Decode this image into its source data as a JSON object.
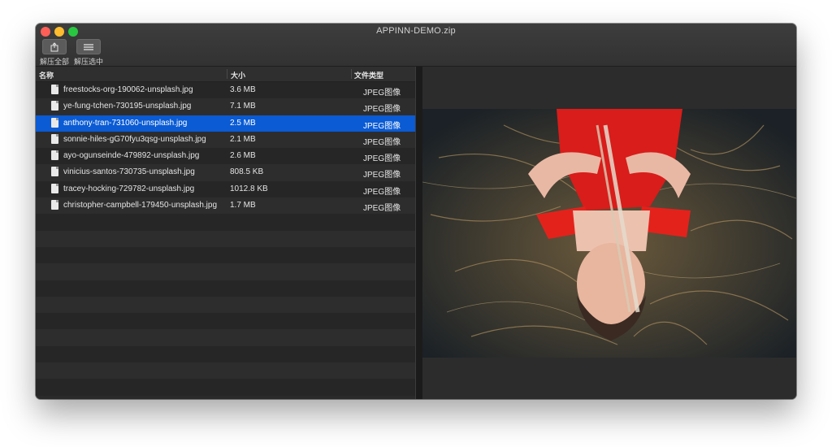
{
  "window": {
    "title": "APPINN-DEMO.zip"
  },
  "toolbar": {
    "extract_all_label": "解压全部",
    "extract_selected_label": "解压选中"
  },
  "columns": {
    "name": "名称",
    "size": "大小",
    "type": "文件类型"
  },
  "files": [
    {
      "name": "freestocks-org-190062-unsplash.jpg",
      "size": "3.6 MB",
      "type": "JPEG图像"
    },
    {
      "name": "ye-fung-tchen-730195-unsplash.jpg",
      "size": "7.1 MB",
      "type": "JPEG图像"
    },
    {
      "name": "anthony-tran-731060-unsplash.jpg",
      "size": "2.5 MB",
      "type": "JPEG图像"
    },
    {
      "name": "sonnie-hiles-gG70fyu3qsg-unsplash.jpg",
      "size": "2.1 MB",
      "type": "JPEG图像"
    },
    {
      "name": "ayo-ogunseinde-479892-unsplash.jpg",
      "size": "2.6 MB",
      "type": "JPEG图像"
    },
    {
      "name": "vinicius-santos-730735-unsplash.jpg",
      "size": "808.5 KB",
      "type": "JPEG图像"
    },
    {
      "name": "tracey-hocking-729782-unsplash.jpg",
      "size": "1012.8 KB",
      "type": "JPEG图像"
    },
    {
      "name": "christopher-campbell-179450-unsplash.jpg",
      "size": "1.7 MB",
      "type": "JPEG图像"
    }
  ],
  "selected_index": 2,
  "colors": {
    "selection": "#0a5bd4",
    "close": "#ff5f57",
    "minimize": "#febc2e",
    "maximize": "#28c840"
  },
  "icons": {
    "extract_all": "share-icon",
    "extract_selected": "list-icon",
    "file": "document-icon"
  }
}
